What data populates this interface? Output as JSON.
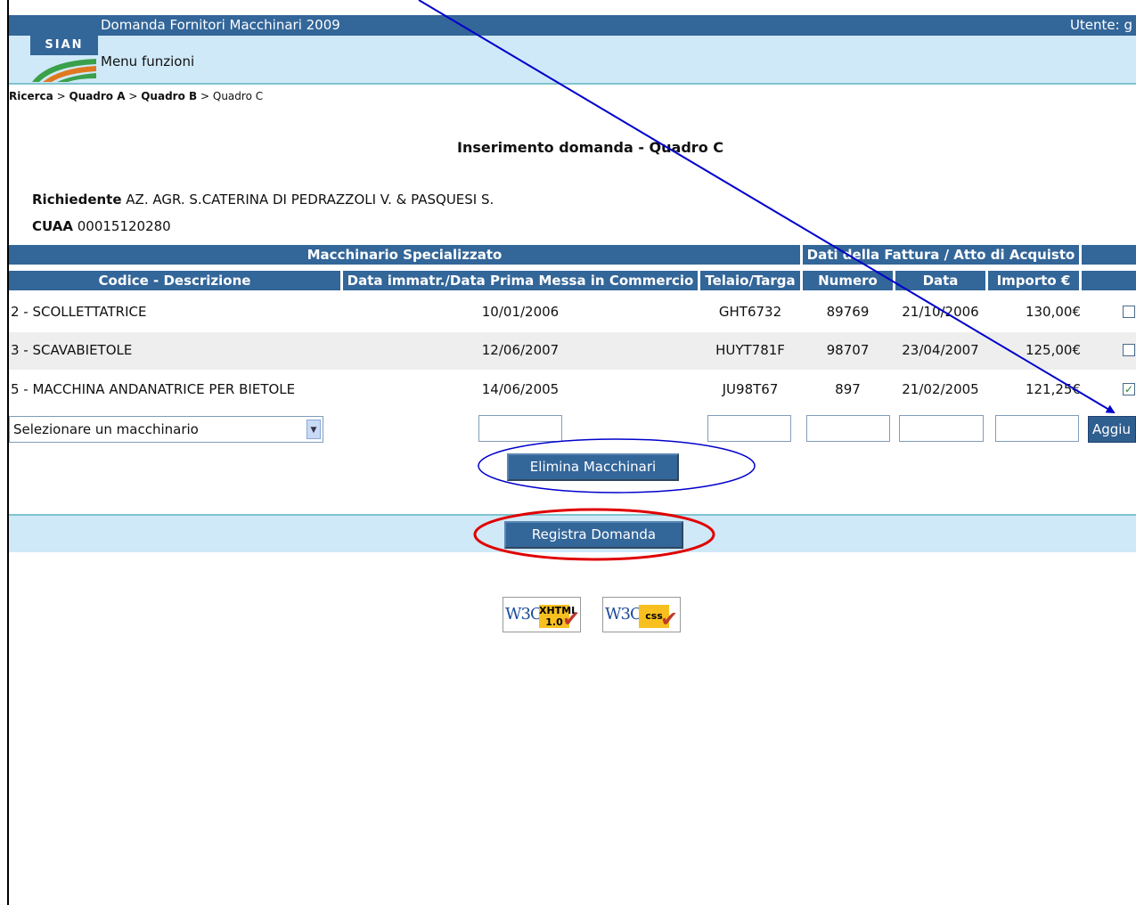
{
  "header": {
    "app_title": "Domanda Fornitori Macchinari 2009",
    "user_label": "Utente: g",
    "logo_text": "SIAN",
    "menu_label": "Menu funzioni"
  },
  "breadcrumb": {
    "items": [
      "Ricerca",
      "Quadro A",
      "Quadro B",
      "Quadro C"
    ],
    "separator": ">"
  },
  "page": {
    "heading": "Inserimento domanda - Quadro C",
    "applicant_label": "Richiedente",
    "applicant_value": "AZ. AGR. S.CATERINA DI PEDRAZZOLI V. & PASQUESI S.",
    "cuaa_label": "CUAA",
    "cuaa_value": "00015120280"
  },
  "table": {
    "group_headers": [
      "Macchinario Specializzato",
      "Dati della Fattura / Atto di Acquisto"
    ],
    "columns": [
      "Codice - Descrizione",
      "Data immatr./Data Prima Messa in Commercio",
      "Telaio/Targa",
      "Numero",
      "Data",
      "Importo €"
    ],
    "rows": [
      {
        "descr": "2 - SCOLLETTATRICE",
        "date_immatr": "10/01/2006",
        "telaio": "GHT6732",
        "numero": "89769",
        "data": "21/10/2006",
        "importo": "130,00€",
        "checked": false
      },
      {
        "descr": "3 - SCAVABIETOLE",
        "date_immatr": "12/06/2007",
        "telaio": "HUYT781F",
        "numero": "98707",
        "data": "23/04/2007",
        "importo": "125,00€",
        "checked": false
      },
      {
        "descr": "5 - MACCHINA ANDANATRICE PER BIETOLE",
        "date_immatr": "14/06/2005",
        "telaio": "JU98T67",
        "numero": "897",
        "data": "21/02/2005",
        "importo": "121,25€",
        "checked": true
      }
    ]
  },
  "form": {
    "select_value": "Selezionare un macchinario",
    "add_button": "Aggiu"
  },
  "actions": {
    "delete_button": "Elimina Macchinari",
    "register_button": "Registra Domanda"
  },
  "badges": {
    "xhtml": {
      "w3c": "W3C",
      "label": "XHTML",
      "version": "1.0"
    },
    "css": {
      "w3c": "W3C",
      "label": "css"
    }
  },
  "annotations": {
    "arrow_color": "#0000cc",
    "delete_ellipse_color": "#0000cc",
    "register_ellipse_color": "#e00000"
  },
  "colors": {
    "header_blue": "#336699",
    "light_band": "#cfe9f8",
    "row_alt": "#eeeeee"
  }
}
